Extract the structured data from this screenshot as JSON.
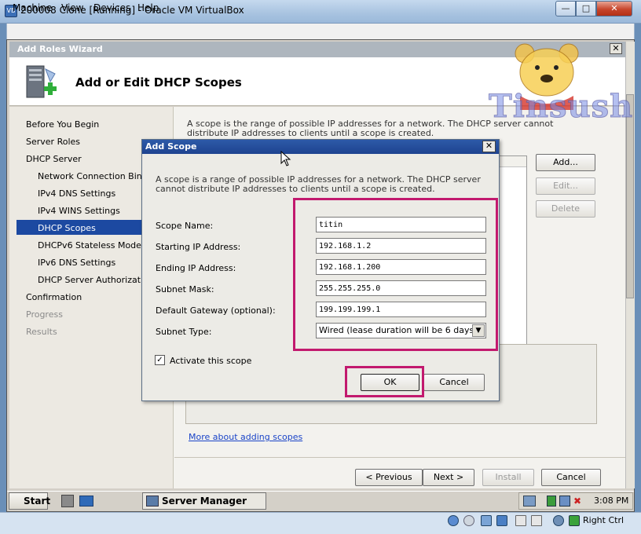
{
  "vbox": {
    "title": "200008 Clone [Running] - Oracle VM VirtualBox",
    "menu": [
      "Machine",
      "View",
      "Devices",
      "Help"
    ],
    "host_key": "Right Ctrl"
  },
  "wizard": {
    "window_title": "Add Roles Wizard",
    "header_title": "Add or Edit DHCP Scopes",
    "sidebar": [
      {
        "label": "Before You Begin"
      },
      {
        "label": "Server Roles"
      },
      {
        "label": "DHCP Server"
      },
      {
        "label": "Network Connection Bindings"
      },
      {
        "label": "IPv4 DNS Settings"
      },
      {
        "label": "IPv4 WINS Settings"
      },
      {
        "label": "DHCP Scopes"
      },
      {
        "label": "DHCPv6 Stateless Mode"
      },
      {
        "label": "IPv6 DNS Settings"
      },
      {
        "label": "DHCP Server Authorization"
      },
      {
        "label": "Confirmation"
      },
      {
        "label": "Progress"
      },
      {
        "label": "Results"
      }
    ],
    "description": "A scope is the range of possible IP addresses for a network. The DHCP server cannot distribute IP addresses to clients until a scope is created.",
    "buttons": {
      "add": "Add...",
      "edit": "Edit...",
      "delete": "Delete"
    },
    "link": "More about adding scopes",
    "footer": {
      "previous": "< Previous",
      "next": "Next >",
      "install": "Install",
      "cancel": "Cancel"
    }
  },
  "dialog": {
    "title": "Add Scope",
    "description": "A scope is a range of possible IP addresses for a network. The DHCP server cannot distribute IP addresses to clients until a scope is created.",
    "fields": {
      "scope_name": {
        "label": "Scope Name:",
        "value": "titin"
      },
      "starting_ip": {
        "label": "Starting IP Address:",
        "value": "192.168.1.2"
      },
      "ending_ip": {
        "label": "Ending IP Address:",
        "value": "192.168.1.200"
      },
      "subnet_mask": {
        "label": "Subnet Mask:",
        "value": "255.255.255.0"
      },
      "gateway": {
        "label": "Default Gateway (optional):",
        "value": "199.199.199.1"
      },
      "subnet_type": {
        "label": "Subnet Type:",
        "value": "Wired (lease duration will be 6 days)"
      }
    },
    "activate_label": "Activate this scope",
    "activate_checked": true,
    "ok": "OK",
    "cancel": "Cancel"
  },
  "taskbar": {
    "start": "Start",
    "task": "Server Manager",
    "clock": "3:08 PM"
  },
  "watermark": {
    "text": "Tinsush"
  },
  "colors": {
    "highlight": "#c2196e",
    "selection": "#1c49a1",
    "link": "#1a44c8"
  }
}
